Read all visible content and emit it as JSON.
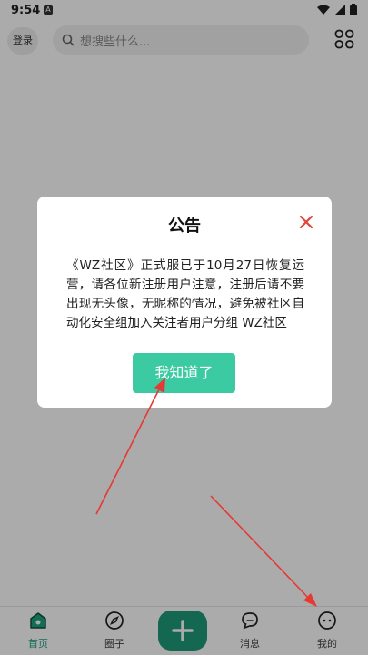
{
  "status_bar": {
    "time": "9:54",
    "notification_badge": "A"
  },
  "header": {
    "login_label": "登录",
    "search_placeholder": "想搜些什么..."
  },
  "announcement": {
    "title": "公告",
    "body": "《WZ社区》正式服已于10月27日恢复运营，请各位新注册用户注意，注册后请不要出现无头像，无昵称的情况，避免被社区自动化安全组加入关注者用户分组 WZ社区",
    "confirm_label": "我知道了"
  },
  "bottom_nav": {
    "items": [
      {
        "label": "首页",
        "icon": "home-icon",
        "active": true
      },
      {
        "label": "圈子",
        "icon": "compass-icon",
        "active": false
      },
      {
        "label": "消息",
        "icon": "message-icon",
        "active": false
      },
      {
        "label": "我的",
        "icon": "profile-icon",
        "active": false
      }
    ],
    "center_button_icon": "plus-icon"
  },
  "colors": {
    "accent": "#3ccaa2",
    "accent_dark": "#1f9a78",
    "close": "#e0443a",
    "annotation_arrow": "#e53935"
  }
}
